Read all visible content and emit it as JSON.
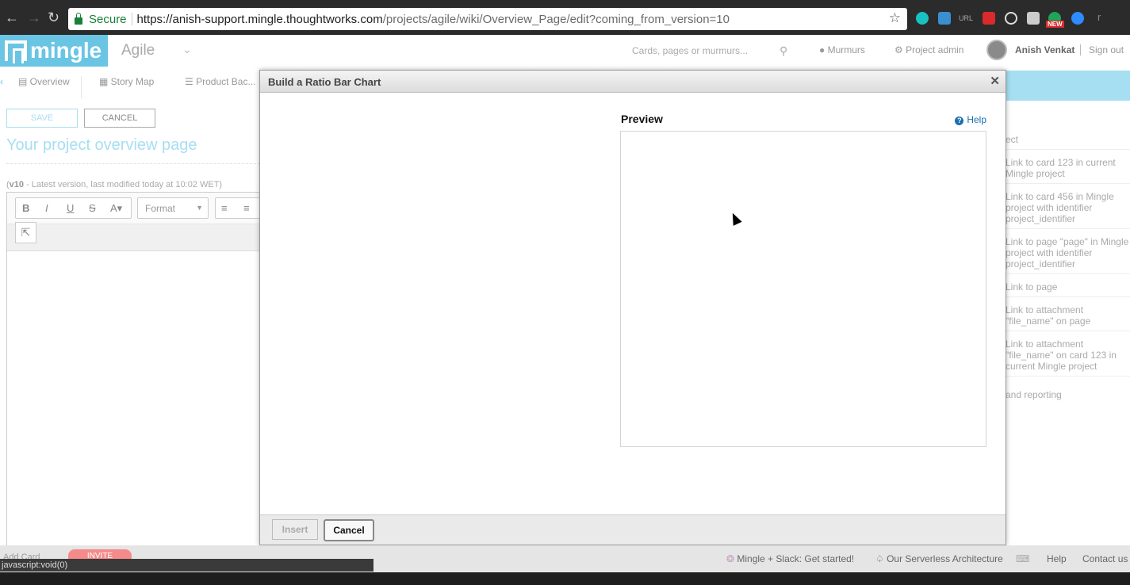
{
  "browser": {
    "secure_label": "Secure",
    "url_host": "https://anish-support.mingle.thoughtworks.com",
    "url_path": "/projects/agile/wiki/Overview_Page/edit?coming_from_version=10",
    "ext_new_badge": "NEW",
    "ext_url_label": "URL"
  },
  "header": {
    "logo_text": "mingle",
    "project_name": "Agile",
    "search_placeholder": "Cards, pages or murmurs...",
    "murmurs": "Murmurs",
    "project_admin": "Project admin",
    "user_name": "Anish Venkat",
    "sign_out": "Sign out"
  },
  "tabs": [
    "Overview",
    "Story Map",
    "Product Bac..."
  ],
  "editor": {
    "save_label": "SAVE",
    "cancel_label": "CANCEL",
    "page_title": "Your project overview page",
    "version_bold": "v10",
    "version_text": " - Latest version, last modified today at 10:02 WET)",
    "format_label": "Format"
  },
  "sidebar": {
    "items": [
      "ect",
      "Link to card 123 in current Mingle project",
      "Link to card 456 in Mingle project with identifier project_identifier",
      "Link to page \"page\" in Mingle project with identifier project_identifier",
      "Link to page",
      "Link to attachment \"file_name\" on page",
      "Link to attachment \"file_name\" on card 123 in current Mingle project",
      "and reporting"
    ]
  },
  "modal": {
    "title": "Build a Ratio Bar Chart",
    "preview_label": "Preview",
    "help_label": "Help",
    "insert_label": "Insert",
    "cancel_label": "Cancel"
  },
  "footer": {
    "add_card": "Add Card",
    "invite": "INVITE",
    "slack": "Mingle + Slack: Get started!",
    "serverless": "Our Serverless Architecture",
    "help": "Help",
    "contact": "Contact us",
    "status_url": "javascript:void(0)"
  }
}
